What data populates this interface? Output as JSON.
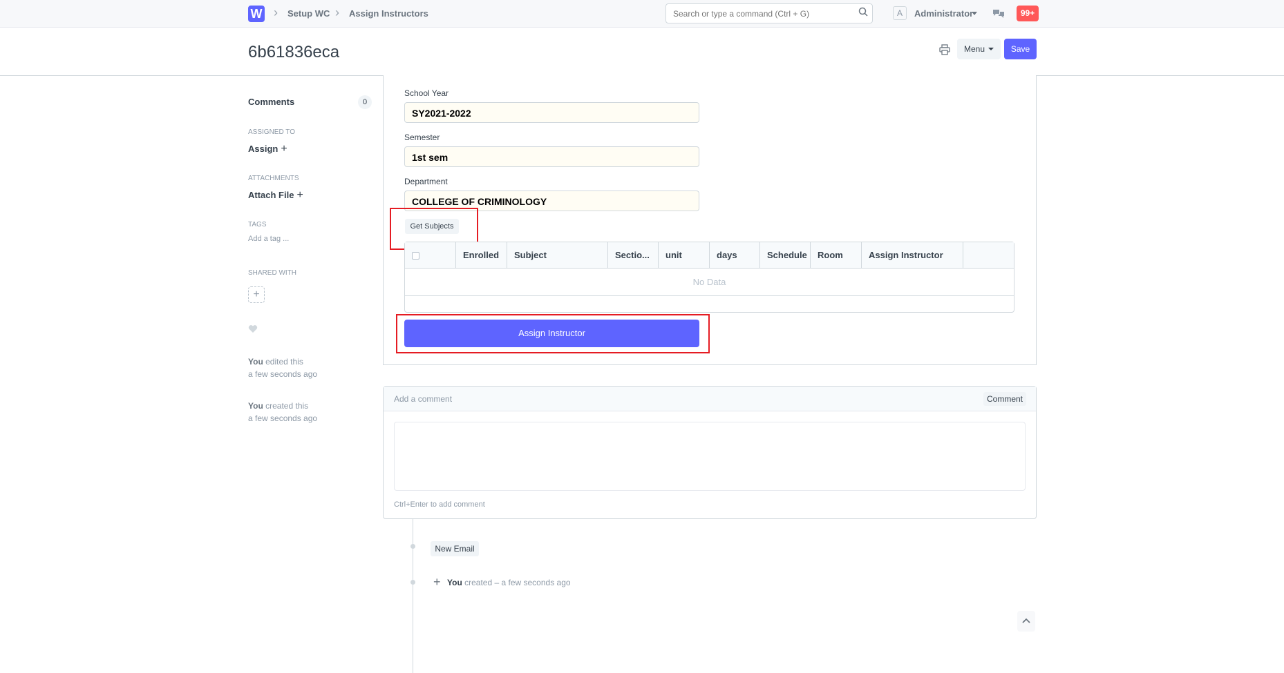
{
  "navbar": {
    "logo": "W",
    "breadcrumbs": [
      "Setup WC",
      "Assign Instructors"
    ],
    "search_placeholder": "Search or type a command (Ctrl + G)",
    "avatar_letter": "A",
    "user": "Administrator",
    "notifications": "99+"
  },
  "page": {
    "title": "6b61836eca",
    "menu_label": "Menu",
    "save_label": "Save"
  },
  "sidebar": {
    "comments_label": "Comments",
    "comments_count": "0",
    "assigned_to_head": "ASSIGNED TO",
    "assign_label": "Assign",
    "attachments_head": "ATTACHMENTS",
    "attach_label": "Attach File",
    "tags_head": "TAGS",
    "add_tag": "Add a tag ...",
    "shared_head": "SHARED WITH",
    "activity": [
      {
        "who": "You",
        "what": "edited this",
        "when": "a few seconds ago"
      },
      {
        "who": "You",
        "what": "created this",
        "when": "a few seconds ago"
      }
    ]
  },
  "form": {
    "school_year_label": "School Year",
    "school_year": "SY2021-2022",
    "semester_label": "Semester",
    "semester": "1st sem",
    "department_label": "Department",
    "department": "COLLEGE OF CRIMINOLOGY",
    "get_subjects": "Get Subjects",
    "grid_columns": [
      "Enrolled",
      "Subject",
      "Sectio...",
      "unit",
      "days",
      "Schedule",
      "Room",
      "Assign Instructor"
    ],
    "no_data": "No Data",
    "assign_button": "Assign Instructor"
  },
  "comment": {
    "placeholder": "Add a comment",
    "button": "Comment",
    "hint": "Ctrl+Enter to add comment"
  },
  "timeline": {
    "new_email": "New Email",
    "entry_who": "You",
    "entry_text": "created – a few seconds ago"
  },
  "colors": {
    "primary": "#5e64ff",
    "highlight": "#e51c23",
    "badge": "#ff5858"
  }
}
